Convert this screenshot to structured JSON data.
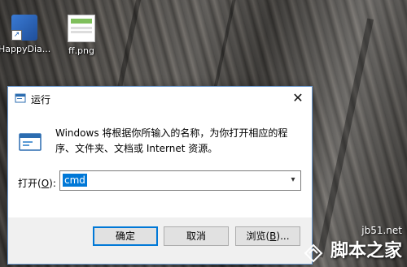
{
  "desktop": {
    "icons": [
      {
        "label": "HappyDia...",
        "icon": "shortcut-app-icon"
      },
      {
        "label": "ff.png",
        "icon": "png-file-icon"
      }
    ]
  },
  "dialog": {
    "title": "运行",
    "close_glyph": "✕",
    "description": "Windows 将根据你所输入的名称，为你打开相应的程序、文件夹、文档或 Internet 资源。",
    "open_label_prefix": "打开(",
    "open_label_key": "O",
    "open_label_suffix": "):",
    "command_value": "cmd",
    "dropdown_glyph": "▾",
    "buttons": {
      "ok": "确定",
      "cancel": "取消",
      "browse_prefix": "浏览(",
      "browse_key": "B",
      "browse_suffix": ")..."
    },
    "accent_color": "#0078d7"
  },
  "watermark": {
    "url": "jb51.net",
    "name": "脚本之家"
  }
}
